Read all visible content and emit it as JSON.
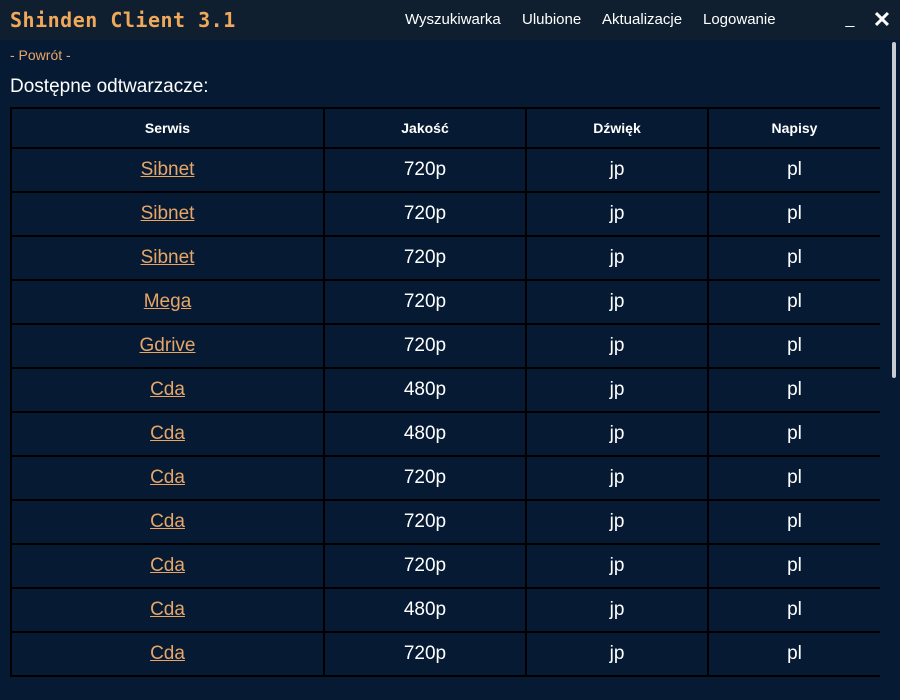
{
  "app": {
    "title": "Shinden Client 3.1"
  },
  "nav": {
    "items": [
      "Wyszukiwarka",
      "Ulubione",
      "Aktualizacje",
      "Logowanie"
    ]
  },
  "window": {
    "minimize": "_",
    "close": "✕"
  },
  "back_label": "- Powrót -",
  "section_title": "Dostępne odtwarzacze:",
  "table": {
    "headers": [
      "Serwis",
      "Jakość",
      "Dźwięk",
      "Napisy"
    ],
    "rows": [
      [
        "Sibnet",
        "720p",
        "jp",
        "pl"
      ],
      [
        "Sibnet",
        "720p",
        "jp",
        "pl"
      ],
      [
        "Sibnet",
        "720p",
        "jp",
        "pl"
      ],
      [
        "Mega",
        "720p",
        "jp",
        "pl"
      ],
      [
        "Gdrive",
        "720p",
        "jp",
        "pl"
      ],
      [
        "Cda",
        "480p",
        "jp",
        "pl"
      ],
      [
        "Cda",
        "480p",
        "jp",
        "pl"
      ],
      [
        "Cda",
        "720p",
        "jp",
        "pl"
      ],
      [
        "Cda",
        "720p",
        "jp",
        "pl"
      ],
      [
        "Cda",
        "720p",
        "jp",
        "pl"
      ],
      [
        "Cda",
        "480p",
        "jp",
        "pl"
      ],
      [
        "Cda",
        "720p",
        "jp",
        "pl"
      ]
    ]
  },
  "colors": {
    "background": "#071a33",
    "titlebar": "#0f1f30",
    "accent": "#e7a667",
    "title_accent": "#f0a95a"
  }
}
